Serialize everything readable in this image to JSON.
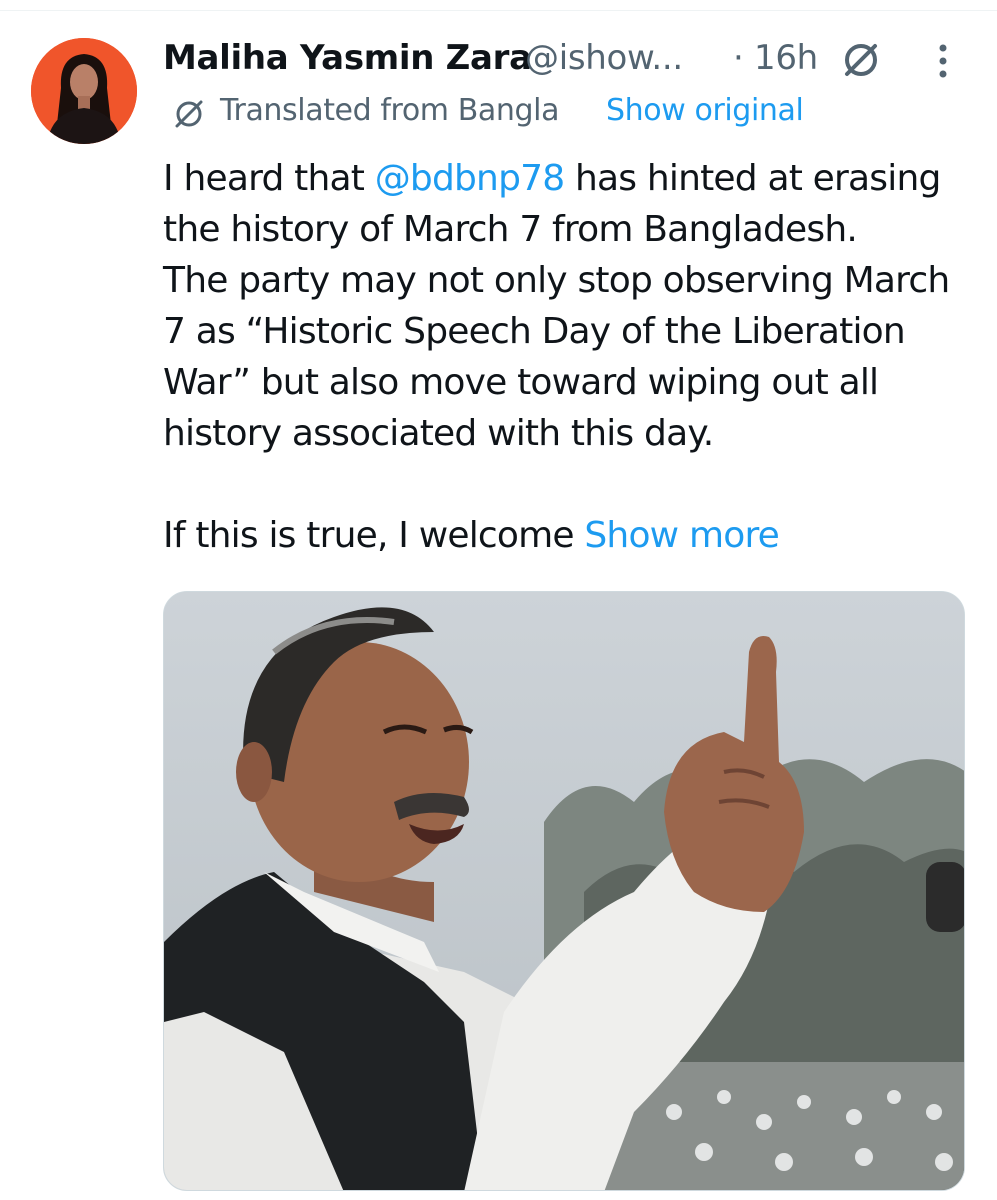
{
  "tweet": {
    "author": {
      "display_name": "Maliha Yasmin Zara",
      "handle": "@ishow...",
      "avatar_icon": "avatar-photo"
    },
    "time": "· 16h",
    "grok_icon": "grok-icon",
    "more_icon": "more-vertical-icon",
    "translation": {
      "icon": "translate-icon",
      "label": "Translated from Bangla",
      "show_original": "Show original"
    },
    "body": {
      "line1_pre": "I heard that ",
      "mention": "@bdbnp78",
      "line1_post": " has hinted at erasing",
      "line2": "the history of March 7 from Bangladesh.",
      "line3": "The party may not only stop observing March",
      "line4": "7 as “Historic Speech Day of the Liberation",
      "line5": "War” but also move toward wiping out all",
      "line6": "history associated with this day.",
      "line7_pre": "If this is true, I welcome ",
      "show_more": "Show more"
    },
    "media": {
      "type": "photo"
    }
  },
  "colors": {
    "text": "#0f1419",
    "secondary": "#536471",
    "link": "#1d9bf0",
    "avatar_bg": "#f0552b"
  }
}
